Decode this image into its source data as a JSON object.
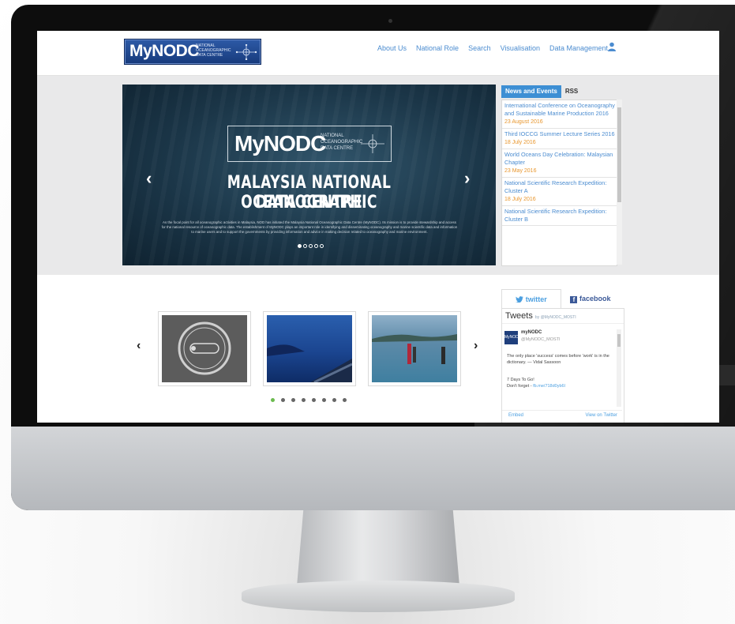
{
  "navbar": {
    "logo_text": "MyNODC",
    "logo_subtitle": "NATIONAL OCEANOGRAPHIC DATA CENTRE",
    "items": [
      "About Us",
      "National Role",
      "Search",
      "Visualisation",
      "Data Management"
    ]
  },
  "slider": {
    "logo_text": "MyNODC",
    "logo_subtitle": "NATIONAL OCEANOGRAPHIC DATA CENTRE",
    "title_line1": "MALAYSIA NATIONAL OCEANOGRAPHIC",
    "title_line2": "DATA CENTRE",
    "description": "As the focal point for all oceanographic activities in Malaysia, NOD has initiated the Malaysia National Oceanographic Data Centre (MyNODC). Its mission is to provide stewardship and access for the national resource of oceanographic data. The establishment of MyNODC plays an important role in identifying and disseminating oceanography and marine scientific data and information to marine users and to support the governments by providing information and advice in making decision related to oceanography and marine environment.",
    "prev_arrow": "‹",
    "next_arrow": "›"
  },
  "news": {
    "tabs": [
      "News and Events",
      "RSS"
    ],
    "items": [
      {
        "title": "International Conference on Oceanography and Sustainable Marine Production 2016",
        "date": "23 August 2016"
      },
      {
        "title": "Third IOCCG Summer Lecture Series 2016",
        "date": "18 July 2016"
      },
      {
        "title": "World Oceans Day Celebration: Malaysian Chapter",
        "date": "23 May 2016"
      },
      {
        "title": "National Scientific Research Expedition: Cluster A",
        "date": "18 July 2016"
      },
      {
        "title": "National Scientific Research Expedition: Cluster B",
        "date": ""
      }
    ]
  },
  "carousel": {
    "prev_arrow": "‹",
    "next_arrow": "›"
  },
  "social": {
    "twitter_tab": "twitter",
    "facebook_tab": "facebook",
    "tweets_heading": "Tweets",
    "tweets_by": "by @MyNODC_MOSTI",
    "tweet_name": "myNODC",
    "tweet_handle": "@MyNODC_MOSTI",
    "tweet_avatar": "MyNODC",
    "tweet_text": "The only place 'success' comes before 'work' is in the dictionary. — Vidal Sassoon",
    "tweet_text2": "7 Days To Go!",
    "tweet_text3": "Don't forget -",
    "tweet_link": "fb.me/718d0yb6l",
    "embed": "Embed",
    "view_on": "View on Twitter"
  },
  "colors": {
    "nav_link": "#4b8cd0",
    "news_tab_active": "#3d8fd4",
    "news_date": "#e8962d",
    "carousel_dot_active": "#6cbb4f",
    "logo_bg": "#1f4a93"
  }
}
